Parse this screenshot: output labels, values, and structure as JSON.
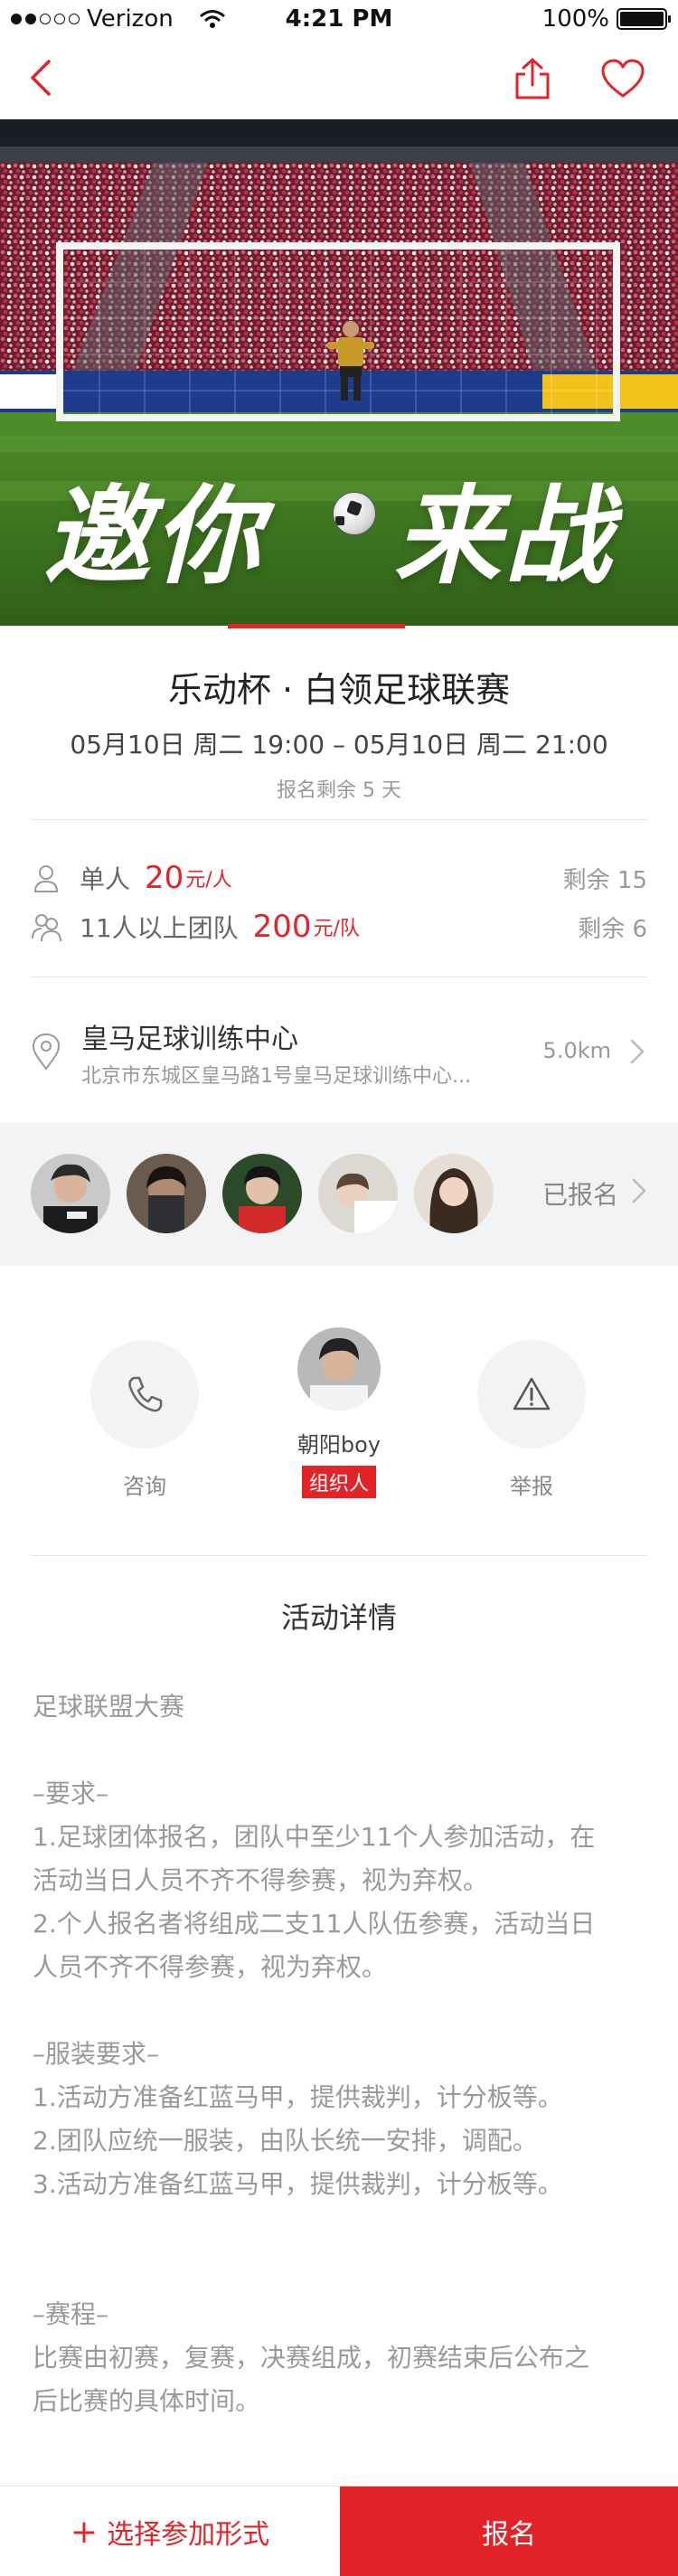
{
  "status_bar": {
    "carrier": "Verizon",
    "time": "4:21 PM",
    "battery": "100%"
  },
  "nav": {
    "back_icon": "chevron-left-icon",
    "share_icon": "share-icon",
    "favorite_icon": "heart-icon",
    "accent": "#e22428"
  },
  "hero": {
    "title_left": "邀你",
    "title_right": "来战"
  },
  "event": {
    "title": "乐动杯 · 白领足球联赛",
    "time": "05月10日 周二 19:00 – 05月10日 周二 21:00",
    "signup_remaining": "报名剩余 5 天"
  },
  "pricing": [
    {
      "icon": "person-icon",
      "label": "单人",
      "price": "20",
      "unit": "元/人",
      "remaining": "剩余 15"
    },
    {
      "icon": "group-icon",
      "label": "11人以上团队",
      "price": "200",
      "unit": "元/队",
      "remaining": "剩余 6"
    }
  ],
  "venue": {
    "icon": "location-pin-icon",
    "name": "皇马足球训练中心",
    "address": "北京市东城区皇马路1号皇马足球训练中心...",
    "distance": "5.0km"
  },
  "participants": {
    "label": "已报名"
  },
  "actions": {
    "consult": {
      "icon": "phone-icon",
      "label": "咨询"
    },
    "report": {
      "icon": "warning-icon",
      "label": "举报"
    },
    "organizer": {
      "name": "朝阳boy",
      "badge": "组织人"
    }
  },
  "details": {
    "section_title": "活动详情",
    "lines": [
      "足球联盟大赛",
      "",
      "–要求–",
      "1.足球团体报名，团队中至少11个人参加活动，在",
      "活动当日人员不齐不得参赛，视为弃权。",
      "2.个人报名者将组成二支11人队伍参赛，活动当日",
      "人员不齐不得参赛，视为弃权。",
      "",
      "–服装要求–",
      "1.活动方准备红蓝马甲，提供裁判，计分板等。",
      "2.团队应统一服装，由队长统一安排，调配。",
      "3.活动方准备红蓝马甲，提供裁判，计分板等。",
      "",
      "",
      "–赛程–",
      "比赛由初赛，复赛，决赛组成，初赛结束后公布之",
      "后比赛的具体时间。"
    ]
  },
  "bottom_bar": {
    "choose_icon": "plus-icon",
    "choose_label": "选择参加形式",
    "signup_label": "报名"
  }
}
